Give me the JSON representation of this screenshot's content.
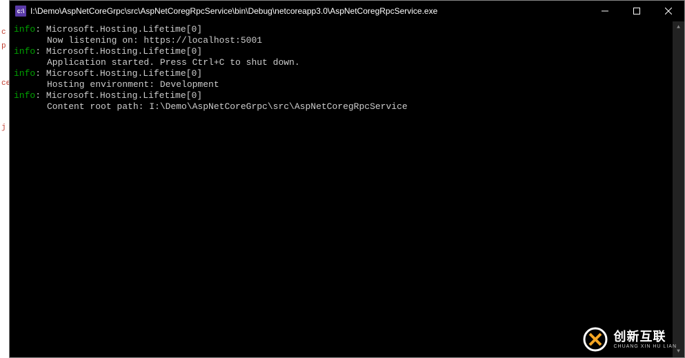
{
  "window": {
    "icon_label": "c:\\",
    "title": "I:\\Demo\\AspNetCoreGrpc\\src\\AspNetCoregRpcService\\bin\\Debug\\netcoreapp3.0\\AspNetCoregRpcService.exe"
  },
  "log": [
    {
      "level": "info",
      "source": "Microsoft.Hosting.Lifetime[0]",
      "message": "Now listening on: https://localhost:5001"
    },
    {
      "level": "info",
      "source": "Microsoft.Hosting.Lifetime[0]",
      "message": "Application started. Press Ctrl+C to shut down."
    },
    {
      "level": "info",
      "source": "Microsoft.Hosting.Lifetime[0]",
      "message": "Hosting environment: Development"
    },
    {
      "level": "info",
      "source": "Microsoft.Hosting.Lifetime[0]",
      "message": "Content root path: I:\\Demo\\AspNetCoreGrpc\\src\\AspNetCoregRpcService"
    }
  ],
  "bg_hints": [
    "c",
    "p",
    "ce",
    "j"
  ],
  "watermark": {
    "cn": "创新互联",
    "en": "CHUANG XIN HU LIAN"
  }
}
